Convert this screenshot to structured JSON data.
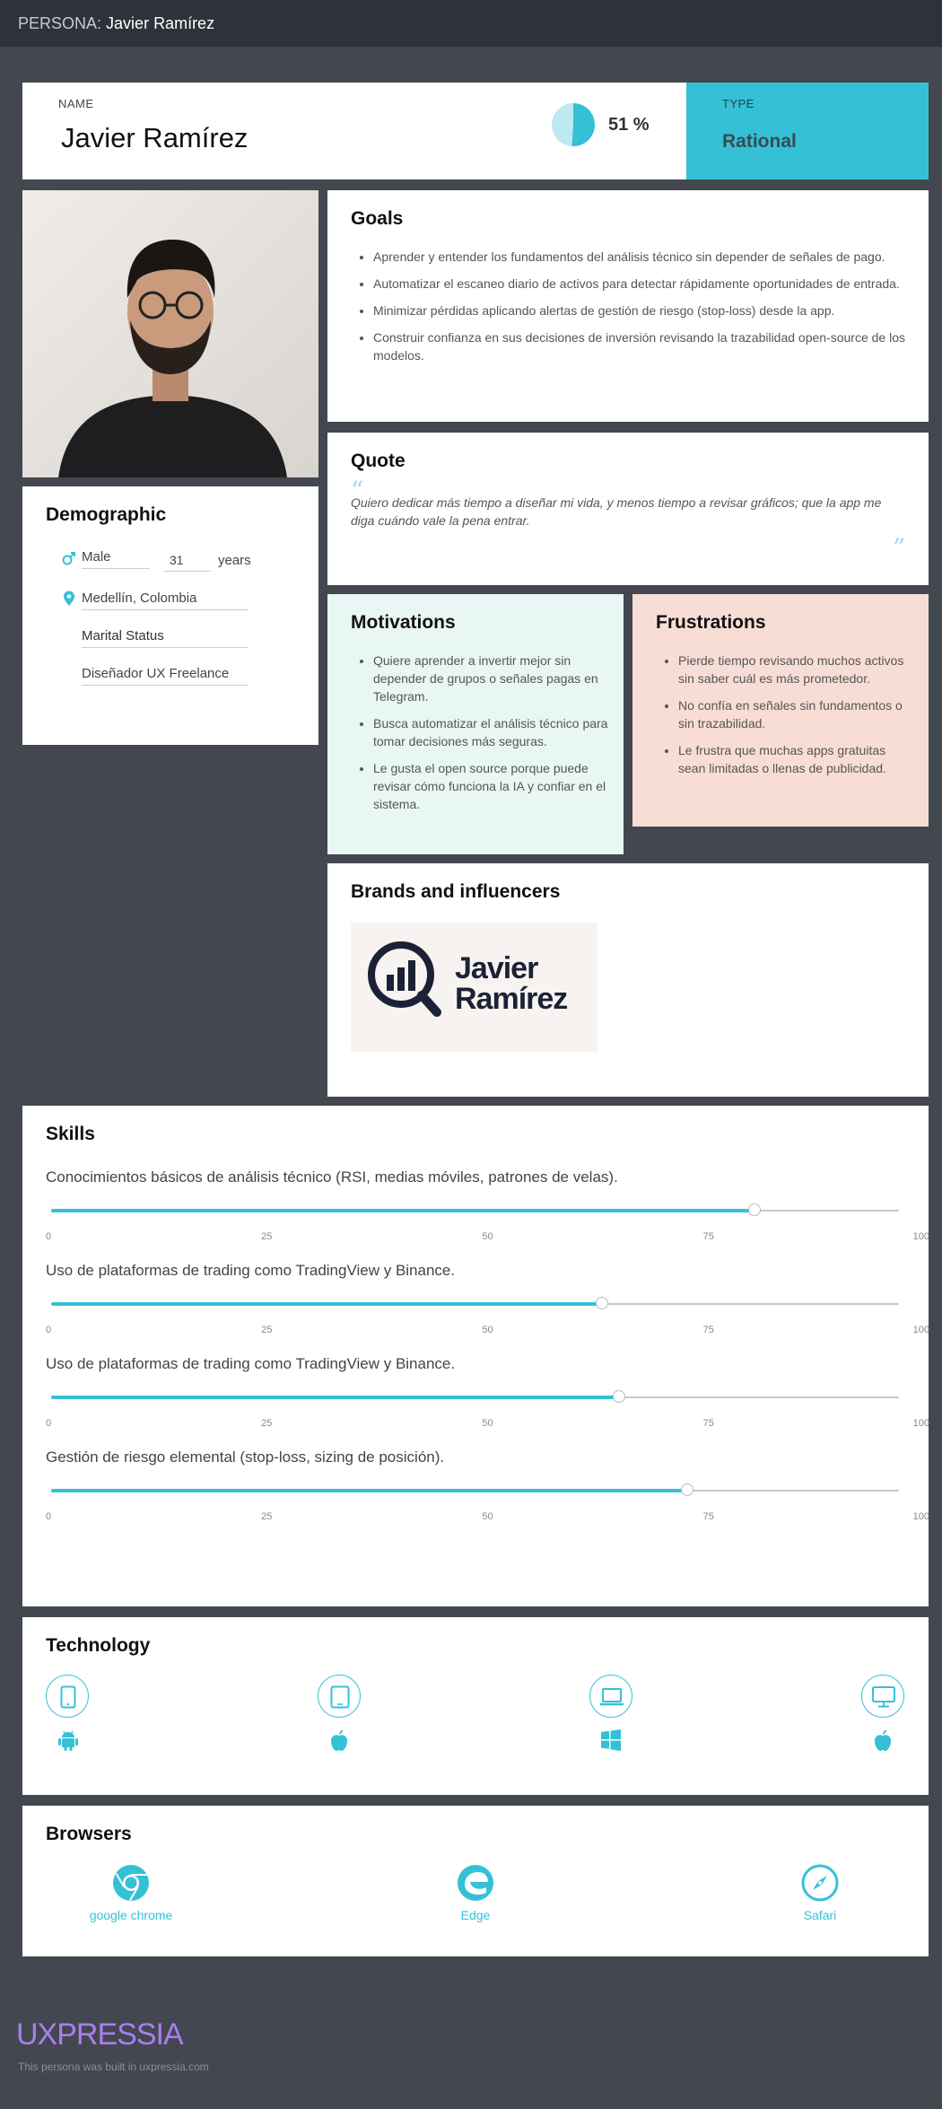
{
  "topbar": {
    "prefix": "PERSONA:",
    "persona_name": "Javier Ramírez"
  },
  "header": {
    "name_label": "NAME",
    "name": "Javier Ramírez",
    "percent_text": "51 %",
    "percent_value": 51,
    "type_label": "TYPE",
    "type_value": "Rational"
  },
  "goals": {
    "title": "Goals",
    "items": [
      "Aprender y entender los fundamentos del análisis técnico sin depender de señales de pago.",
      "Automatizar el escaneo diario de activos para detectar rápidamente oportunidades de entrada.",
      "Minimizar pérdidas aplicando alertas de gestión de riesgo (stop-loss) desde la app.",
      "Construir confianza en sus decisiones de inversión revisando la trazabilidad open-source de los modelos."
    ]
  },
  "quote": {
    "title": "Quote",
    "text": "Quiero dedicar más tiempo a diseñar mi vida, y menos tiempo a revisar gráficos; que la app me diga cuándo vale la pena entrar."
  },
  "demographic": {
    "title": "Demographic",
    "gender": "Male",
    "age": "31",
    "age_unit": "years",
    "location": "Medellín, Colombia",
    "marital_status": "Marital Status",
    "occupation": "Diseñador UX Freelance"
  },
  "motivations": {
    "title": "Motivations",
    "bg": "#e8f7f3",
    "items": [
      "Quiere aprender a invertir mejor sin depender de grupos o señales pagas en Telegram.",
      "Busca automatizar el análisis técnico para tomar decisiones más seguras.",
      "Le gusta el open source porque puede revisar cómo funciona la IA y confiar en el sistema."
    ]
  },
  "frustrations": {
    "title": "Frustrations",
    "bg": "#f8ddd6",
    "items": [
      "Pierde tiempo revisando muchos activos sin saber cuál es más prometedor.",
      "No confía en señales sin fundamentos o sin trazabilidad.",
      "Le frustra que muchas apps gratuitas sean limitadas o llenas de publicidad."
    ]
  },
  "brands": {
    "title": "Brands and influencers",
    "logo_line1": "Javier",
    "logo_line2": "Ramírez"
  },
  "skills": {
    "title": "Skills",
    "ticks": [
      "0",
      "25",
      "50",
      "75",
      "100"
    ],
    "items": [
      {
        "label": "Conocimientos básicos de análisis técnico (RSI, medias móviles, patrones de velas).",
        "value": 83
      },
      {
        "label": "Uso de plataformas de trading como TradingView y Binance.",
        "value": 65
      },
      {
        "label": "Uso de plataformas de trading como TradingView y Binance.",
        "value": 67
      },
      {
        "label": "Gestión de riesgo elemental (stop-loss, sizing de posición).",
        "value": 75
      }
    ]
  },
  "technology": {
    "title": "Technology",
    "devices": [
      {
        "device": "smartphone-icon",
        "os": "android-icon"
      },
      {
        "device": "tablet-icon",
        "os": "apple-icon"
      },
      {
        "device": "laptop-icon",
        "os": "windows-icon"
      },
      {
        "device": "desktop-icon",
        "os": "apple-icon"
      }
    ]
  },
  "browsers": {
    "title": "Browsers",
    "items": [
      {
        "label": "google chrome",
        "icon": "chrome-icon"
      },
      {
        "label": "Edge",
        "icon": "edge-icon"
      },
      {
        "label": "Safari",
        "icon": "safari-icon"
      }
    ]
  },
  "footer": {
    "brand": "UXPRESSIA",
    "note": "This persona was built in uxpressia.com"
  },
  "colors": {
    "accent": "#34c1d6",
    "brand_purple": "#a97ef0",
    "page_bg": "#434750",
    "topbar_bg": "#2f323a"
  }
}
